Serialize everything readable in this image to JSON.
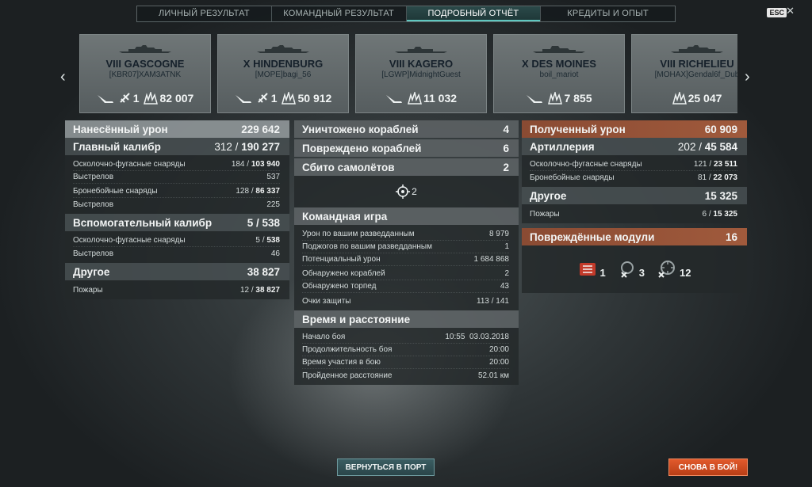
{
  "tabs": [
    "ЛИЧНЫЙ РЕЗУЛЬТАТ",
    "КОМАНДНЫЙ РЕЗУЛЬТАТ",
    "ПОДРОБНЫЙ ОТЧЁТ",
    "КРЕДИТЫ И ОПЫТ"
  ],
  "esc_label": "ESC",
  "close_glyph": "✕",
  "nav": {
    "prev": "‹",
    "next": "›"
  },
  "ships": [
    {
      "name": "VIII GASCOGNE",
      "player": "[KBR07]XAM3ATNK",
      "planes": "1",
      "damage": "82 007"
    },
    {
      "name": "X HINDENBURG",
      "player": "[MOPE]bagi_56",
      "planes": "1",
      "damage": "50 912"
    },
    {
      "name": "VIII KAGERO",
      "player": "[LGWP]MidnightGuest",
      "damage": "11 032"
    },
    {
      "name": "X DES MOINES",
      "player": "boil_mariot",
      "damage": "7 855"
    },
    {
      "name": "VIII RICHELIEU",
      "player": "[MOHAX]Gendal6f_Dub",
      "damage": "25 047"
    }
  ],
  "left": {
    "dealt": {
      "label": "Нанесённый урон",
      "value": "229 642"
    },
    "main": {
      "label": "Главный калибр",
      "hits": "312 / ",
      "value": "190 277"
    },
    "he": {
      "label": "Осколочно-фугасные снаряды",
      "hits": "184 / ",
      "value": "103 940"
    },
    "he_shots": {
      "label": "Выстрелов",
      "value": "537"
    },
    "ap": {
      "label": "Бронебойные снаряды",
      "hits": "128 / ",
      "value": "86 337"
    },
    "ap_shots": {
      "label": "Выстрелов",
      "value": "225"
    },
    "secondary": {
      "label": "Вспомогательный калибр",
      "value": "5 / 538"
    },
    "sec_he": {
      "label": "Осколочно-фугасные снаряды",
      "hits": "5 / ",
      "value": "538"
    },
    "sec_shots": {
      "label": "Выстрелов",
      "value": "46"
    },
    "other": {
      "label": "Другое",
      "value": "38 827"
    },
    "fires": {
      "label": "Пожары",
      "hits": "12 / ",
      "value": "38 827"
    }
  },
  "mid": {
    "destroyed": {
      "label": "Уничтожено кораблей",
      "value": "4"
    },
    "damaged": {
      "label": "Повреждено кораблей",
      "value": "6"
    },
    "planes": {
      "label": "Сбито самолётов",
      "value": "2"
    },
    "icon_count": "2",
    "team": {
      "label": "Командная игра"
    },
    "team_rows": [
      {
        "label": "Урон по вашим разведданным",
        "value": "8 979"
      },
      {
        "label": "Поджогов по вашим разведданным",
        "value": "1"
      },
      {
        "label": "Потенциальный урон",
        "value": "1 684 868"
      },
      {
        "label": "Обнаружено кораблей",
        "value": "2"
      },
      {
        "label": "Обнаружено торпед",
        "value": "43"
      },
      {
        "label": "Очки защиты",
        "value": "113 / 141"
      }
    ],
    "time": {
      "label": "Время и расстояние"
    },
    "time_rows": [
      {
        "label": "Начало боя",
        "value": "10:55  03.03.2018"
      },
      {
        "label": "Продолжительность боя",
        "value": "20:00"
      },
      {
        "label": "Время участия в бою",
        "value": "20:00"
      },
      {
        "label": "Пройденное расстояние",
        "value": "52.01 км"
      }
    ]
  },
  "right": {
    "received": {
      "label": "Полученный урон",
      "value": "60 909"
    },
    "artillery": {
      "label": "Артиллерия",
      "hits": "202 / ",
      "value": "45 584"
    },
    "he": {
      "label": "Осколочно-фугасные снаряды",
      "hits": "121 / ",
      "value": "23 511"
    },
    "ap": {
      "label": "Бронебойные снаряды",
      "hits": "81 / ",
      "value": "22 073"
    },
    "other": {
      "label": "Другое",
      "value": "15 325"
    },
    "fires": {
      "label": "Пожары",
      "hits": "6 / ",
      "value": "15 325"
    },
    "modules": {
      "label": "Повреждённые модули",
      "value": "16"
    },
    "module_counts": [
      "1",
      "3",
      "12"
    ]
  },
  "buttons": {
    "port": "ВЕРНУТЬСЯ В ПОРТ",
    "battle": "СНОВА В БОЙ!"
  },
  "colors": {
    "accent": "#5fc7c0",
    "received": "#a05a3c",
    "battle": "#e25a2c",
    "port": "#3b5e63"
  }
}
